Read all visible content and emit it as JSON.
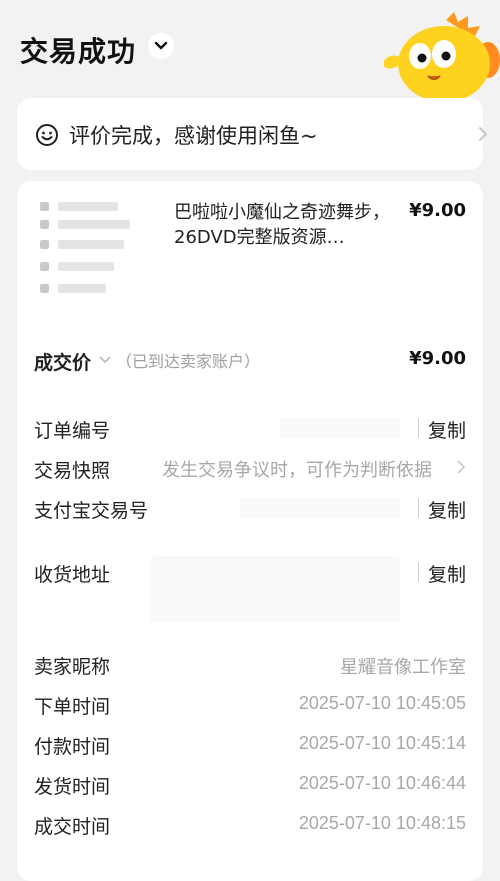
{
  "header": {
    "title": "交易成功",
    "toggle_icon": "chevron-down-icon",
    "mascot_icon": "fish-mascot-icon"
  },
  "review": {
    "icon": "smile-face-icon",
    "text": "评价完成，感谢使用闲鱼~"
  },
  "item": {
    "title": "巴啦啦小魔仙之奇迹舞步，26DVD完整版资源…",
    "price": "¥9.00"
  },
  "deal": {
    "label": "成交价",
    "note": "（已到达卖家账户）",
    "price": "¥9.00"
  },
  "rows": {
    "order_no_label": "订单编号",
    "snapshot_label": "交易快照",
    "snapshot_value": "发生交易争议时，可作为判断依据",
    "alipay_label": "支付宝交易号",
    "address_label": "收货地址",
    "copy_label": "复制",
    "seller_label": "卖家昵称",
    "seller_value": "星耀音像工作室",
    "order_time_label": "下单时间",
    "order_time": "2025-07-10 10:45:05",
    "pay_time_label": "付款时间",
    "pay_time": "2025-07-10 10:45:14",
    "ship_time_label": "发货时间",
    "ship_time": "2025-07-10 10:46:44",
    "done_time_label": "成交时间",
    "done_time": "2025-07-10 10:48:15"
  },
  "colors": {
    "background": "#f2f2f2",
    "card": "#ffffff",
    "mascot_yellow": "#ffd21f",
    "mascot_orange": "#ff8a1f",
    "muted_text": "#a8a8a8"
  }
}
